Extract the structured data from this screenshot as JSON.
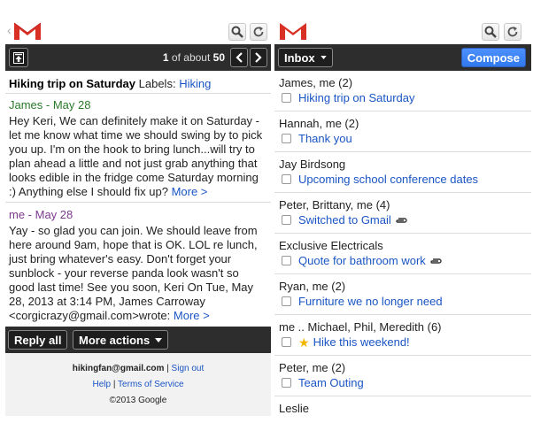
{
  "left": {
    "back_glyph": "‹",
    "counter_pre": "1",
    "counter_mid": " of about ",
    "counter_total": "50",
    "subject": "Hiking trip on Saturday",
    "labels_prefix": "Labels:",
    "label": "Hiking",
    "messages": [
      {
        "header": "James - May 28",
        "body": "Hey Keri, We can definitely make it on Saturday - let me know what time we should swing by to pick you up. I'm on the hook to bring lunch...will try to plan ahead a little and not just grab anything that looks edible in the fridge come Saturday morning :) Anything else I should fix up?",
        "more": "More >"
      },
      {
        "header": "me - May 28",
        "body": "Yay - so glad you can join. We should leave from here around 9am, hope that is OK. LOL re lunch, just bring whatever's easy. Don't forget your sunblock - your reverse panda look wasn't so good last time! See you soon, Keri On Tue, May 28, 2013 at 3:14 PM, James Carroway <corgicrazy@gmail.com>wrote:",
        "more": "More >"
      }
    ],
    "reply_all": "Reply all",
    "more_actions": "More actions",
    "footer": {
      "email": "hikingfan@gmail.com",
      "sep": " | ",
      "sign_out": "Sign out",
      "help": "Help",
      "terms": "Terms of Service",
      "copyright": "©2013 Google"
    }
  },
  "right": {
    "inbox": "Inbox",
    "compose": "Compose",
    "threads": [
      {
        "sender": "James, me (2)",
        "subject": "Hiking trip on Saturday",
        "star": false,
        "attach": false
      },
      {
        "sender": "Hannah, me (2)",
        "subject": "Thank you",
        "star": false,
        "attach": false
      },
      {
        "sender": "Jay Birdsong",
        "subject": "Upcoming school conference dates",
        "star": false,
        "attach": false
      },
      {
        "sender": "Peter, Brittany, me (4)",
        "subject": "Switched to Gmail",
        "star": false,
        "attach": true
      },
      {
        "sender": "Exclusive Electricals",
        "subject": "Quote for bathroom work",
        "star": false,
        "attach": true
      },
      {
        "sender": "Ryan, me (2)",
        "subject": "Furniture we no longer need",
        "star": false,
        "attach": false
      },
      {
        "sender": "me .. Michael, Phil, Meredith (6)",
        "subject": "Hike this weekend!",
        "star": true,
        "attach": false
      },
      {
        "sender": "Peter, me (2)",
        "subject": "Team Outing",
        "star": false,
        "attach": false
      },
      {
        "sender": "Leslie",
        "subject": "",
        "star": false,
        "attach": false
      }
    ]
  },
  "colors": {
    "dark_bar": "#2d2d2d",
    "link": "#1a55c4",
    "james_header": "#2a7a2a",
    "me_header": "#7b3a8c",
    "compose_blue": "#3f84f2",
    "star": "#f3b600"
  },
  "icons": [
    "gmail-logo-icon",
    "search-icon",
    "refresh-icon",
    "archive-icon",
    "chevron-left-icon",
    "chevron-right-icon",
    "dropdown-caret-icon",
    "star-icon",
    "paperclip-icon"
  ]
}
